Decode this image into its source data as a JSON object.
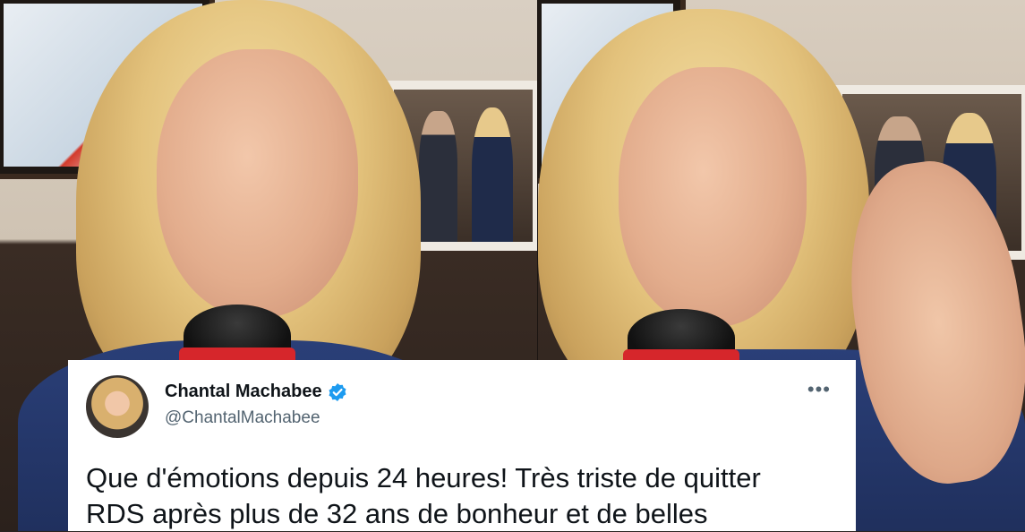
{
  "tweet": {
    "display_name": "Chantal Machabee",
    "handle": "@ChantalMachabee",
    "text_line_1": "Que d'émotions depuis 24 heures! Très triste de quitter",
    "text_line_2": "RDS après plus de 32 ans de bonheur et de belles",
    "more_icon": "more-horizontal-icon",
    "verified_icon": "verified-badge-icon",
    "verified_color": "#1d9bf0"
  }
}
